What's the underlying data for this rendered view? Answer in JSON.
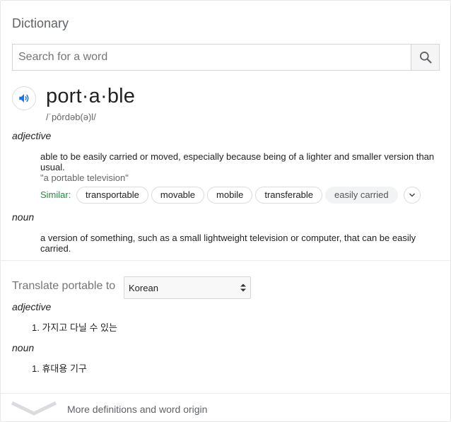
{
  "header": {
    "title": "Dictionary"
  },
  "search": {
    "placeholder": "Search for a word",
    "value": ""
  },
  "entry": {
    "word": "port·a·ble",
    "phonetic": "/ˈpôrdəb(ə)l/",
    "senses": [
      {
        "pos": "adjective",
        "definition": "able to be easily carried or moved, especially because being of a lighter and smaller version than usual.",
        "example": "\"a portable television\"",
        "similar_label": "Similar:",
        "similar": [
          "transportable",
          "movable",
          "mobile",
          "transferable",
          "easily carried"
        ]
      },
      {
        "pos": "noun",
        "definition": "a version of something, such as a small lightweight television or computer, that can be easily carried."
      }
    ]
  },
  "translate": {
    "label": "Translate portable to",
    "language": "Korean",
    "groups": [
      {
        "pos": "adjective",
        "items": [
          "1. 가지고 다닐 수 있는"
        ]
      },
      {
        "pos": "noun",
        "items": [
          "1. 휴대용 기구"
        ]
      }
    ]
  },
  "footer": {
    "more_label": "More definitions and word origin"
  },
  "colors": {
    "accent": "#1a73e8",
    "similar_green": "#1e8e3e",
    "chip_border": "#dadce0"
  },
  "icons": {
    "search": "search-icon",
    "speaker": "speaker-icon",
    "expand": "chevron-down-icon",
    "select": "select-arrows-icon"
  }
}
